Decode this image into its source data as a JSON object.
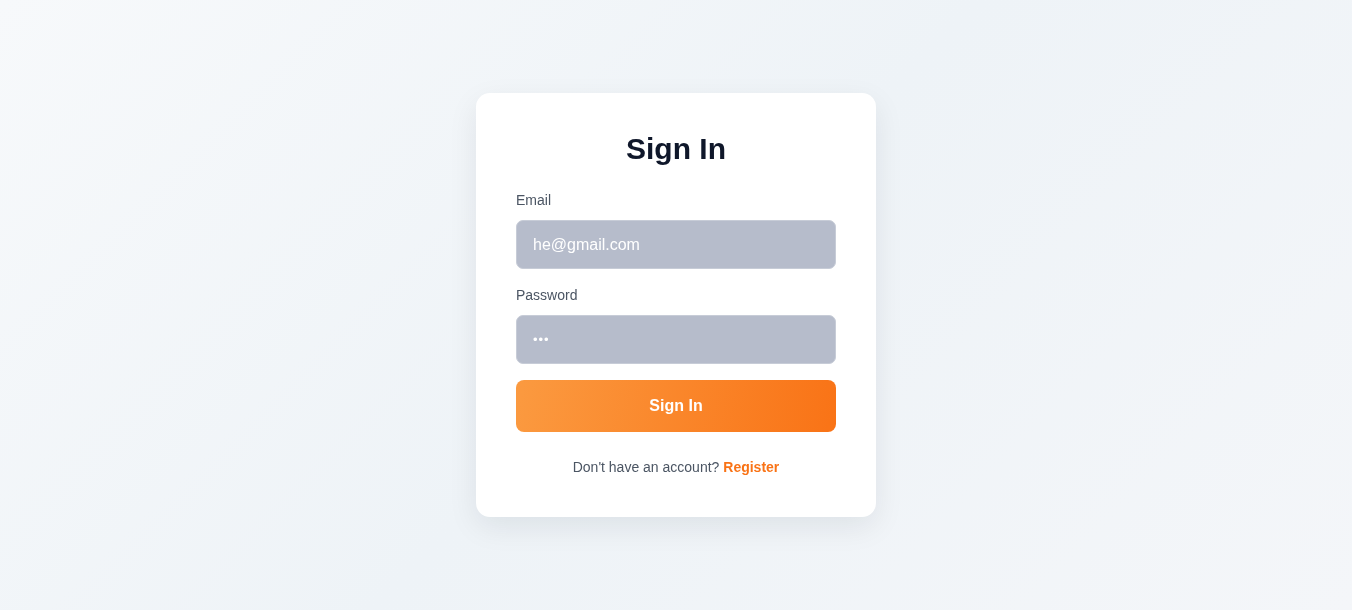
{
  "title": "Sign In",
  "fields": [
    {
      "kind": "text",
      "label": "Email",
      "value": "he@gmail.com"
    },
    {
      "kind": "password",
      "label": "Password",
      "value": "•••"
    }
  ],
  "submit_button": {
    "label": "Sign In"
  },
  "footer": {
    "text": "Don't have an account?",
    "link": "Register"
  }
}
